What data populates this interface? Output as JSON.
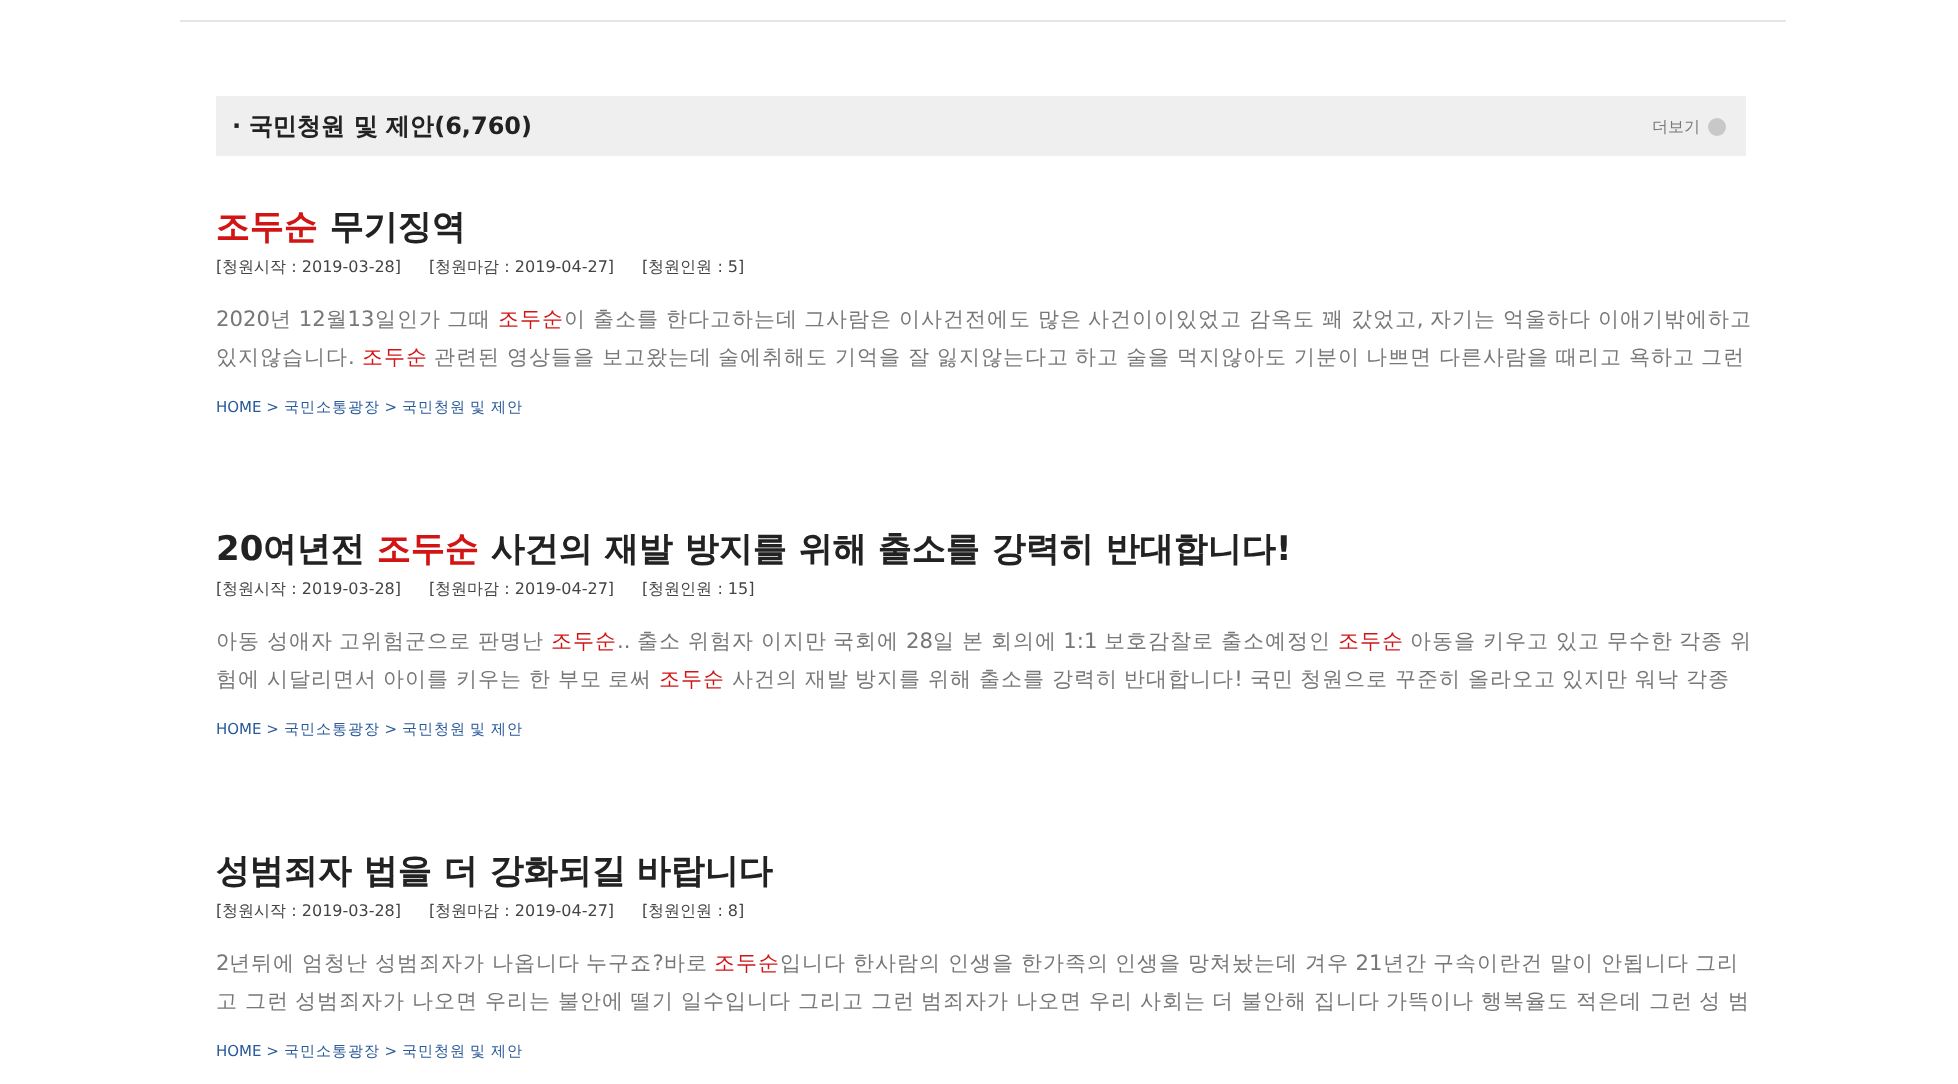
{
  "section": {
    "title": "· 국민청원 및 제안(6,760)",
    "more": "더보기"
  },
  "petitions": [
    {
      "title": [
        {
          "text": "조두순",
          "highlight": true
        },
        {
          "text": " 무기징역",
          "highlight": false
        }
      ],
      "meta": [
        "[청원시작 : 2019-03-28]",
        "[청원마감 : 2019-04-27]",
        "[청원인원 : 5]"
      ],
      "body": [
        [
          {
            "text": "2020년 12월13일인가 그때 ",
            "highlight": false
          },
          {
            "text": "조두순",
            "highlight": true
          },
          {
            "text": "이 출소를 한다고하는데 그사람은 이사건전에도 많은 사건이이있었고 감옥도 꽤 갔었고, 자기는 억울하다 이애기밖에하고",
            "highlight": false
          }
        ],
        [
          {
            "text": "있지않습니다. ",
            "highlight": false
          },
          {
            "text": "조두순",
            "highlight": true
          },
          {
            "text": " 관련된 영상들을 보고왔는데 술에취해도 기억을 잘 잃지않는다고 하고 술을 먹지않아도 기분이 나쁘면 다른사람을 때리고 욕하고 그런",
            "highlight": false
          }
        ]
      ],
      "breadcrumb": "HOME > 국민소통광장 > 국민청원 및 제안"
    },
    {
      "title": [
        {
          "text": "20여년전 ",
          "highlight": false
        },
        {
          "text": "조두순",
          "highlight": true
        },
        {
          "text": " 사건의 재발 방지를 위해 출소를 강력히 반대합니다!",
          "highlight": false
        }
      ],
      "meta": [
        "[청원시작 : 2019-03-28]",
        "[청원마감 : 2019-04-27]",
        "[청원인원 : 15]"
      ],
      "body": [
        [
          {
            "text": "아동 성애자 고위험군으로 판명난 ",
            "highlight": false
          },
          {
            "text": "조두순",
            "highlight": true
          },
          {
            "text": ".. 출소 위험자 이지만 국회에 28일 본 회의에 1:1 보호감찰로 출소예정인 ",
            "highlight": false
          },
          {
            "text": "조두순",
            "highlight": true
          },
          {
            "text": " 아동을 키우고 있고 무수한 각종 위",
            "highlight": false
          }
        ],
        [
          {
            "text": "험에 시달리면서 아이를 키우는 한 부모 로써 ",
            "highlight": false
          },
          {
            "text": "조두순",
            "highlight": true
          },
          {
            "text": " 사건의 재발 방지를 위해 출소를 강력히 반대합니다! 국민 청원으로 꾸준히 올라오고 있지만 워낙 각종",
            "highlight": false
          }
        ]
      ],
      "breadcrumb": "HOME > 국민소통광장 > 국민청원 및 제안"
    },
    {
      "title": [
        {
          "text": "성범죄자 법을 더 강화되길 바랍니다",
          "highlight": false
        }
      ],
      "meta": [
        "[청원시작 : 2019-03-28]",
        "[청원마감 : 2019-04-27]",
        "[청원인원 : 8]"
      ],
      "body": [
        [
          {
            "text": "2년뒤에 엄청난 성범죄자가 나옵니다 누구죠?바로 ",
            "highlight": false
          },
          {
            "text": "조두순",
            "highlight": true
          },
          {
            "text": "입니다 한사람의 인생을 한가족의 인생을 망쳐놨는데 겨우 21년간 구속이란건 말이 안됩니다 그리",
            "highlight": false
          }
        ],
        [
          {
            "text": "고 그런 성범죄자가 나오면 우리는 불안에 떨기 일수입니다 그리고 그런 범죄자가 나오면 우리 사회는 더 불안해 집니다 가뜩이나 행복율도 적은데 그런 성 범",
            "highlight": false
          }
        ]
      ],
      "breadcrumb": "HOME > 국민소통광장 > 국민청원 및 제안"
    }
  ]
}
